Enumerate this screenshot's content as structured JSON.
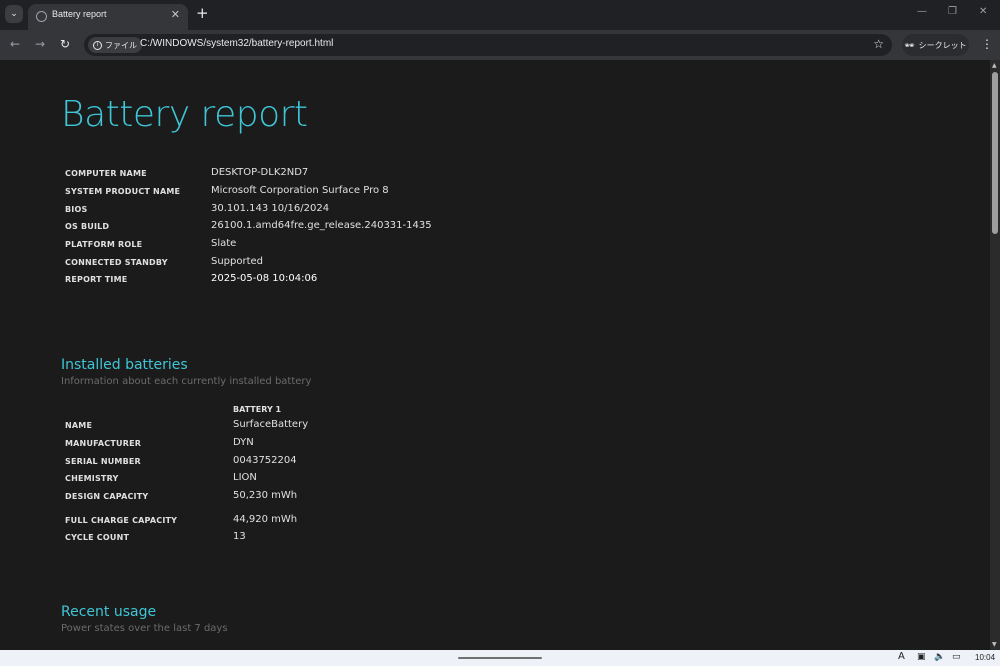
{
  "browser": {
    "tab_title": "Battery report",
    "site_chip_label": "ファイル",
    "url": "C:/WINDOWS/system32/battery-report.html",
    "incognito_label": "シークレット"
  },
  "report": {
    "title": "Battery report",
    "system_info": [
      {
        "key": "COMPUTER NAME",
        "value": "DESKTOP-DLK2ND7"
      },
      {
        "key": "SYSTEM PRODUCT NAME",
        "value": "Microsoft Corporation Surface Pro 8"
      },
      {
        "key": "BIOS",
        "value": "30.101.143 10/16/2024"
      },
      {
        "key": "OS BUILD",
        "value": "26100.1.amd64fre.ge_release.240331-1435"
      },
      {
        "key": "PLATFORM ROLE",
        "value": "Slate"
      },
      {
        "key": "CONNECTED STANDBY",
        "value": "Supported"
      },
      {
        "key": "REPORT TIME",
        "value": "2025-05-08  10:04:06"
      }
    ],
    "installed_batteries": {
      "title": "Installed batteries",
      "subtitle": "Information about each currently installed battery",
      "column_header": "BATTERY 1",
      "rows": [
        {
          "key": "NAME",
          "value": "SurfaceBattery"
        },
        {
          "key": "MANUFACTURER",
          "value": "DYN"
        },
        {
          "key": "SERIAL NUMBER",
          "value": "0043752204"
        },
        {
          "key": "CHEMISTRY",
          "value": "LION"
        },
        {
          "key": "DESIGN CAPACITY",
          "value": "50,230 mWh"
        },
        {
          "key": "FULL CHARGE CAPACITY",
          "value": "44,920 mWh"
        },
        {
          "key": "CYCLE COUNT",
          "value": "13"
        }
      ]
    },
    "recent_usage": {
      "title": "Recent usage",
      "subtitle": "Power states over the last 7 days"
    }
  },
  "taskbar": {
    "clock": "10:04"
  },
  "colors": {
    "accent": "#3fc6d6",
    "background": "#1b1b1b"
  }
}
